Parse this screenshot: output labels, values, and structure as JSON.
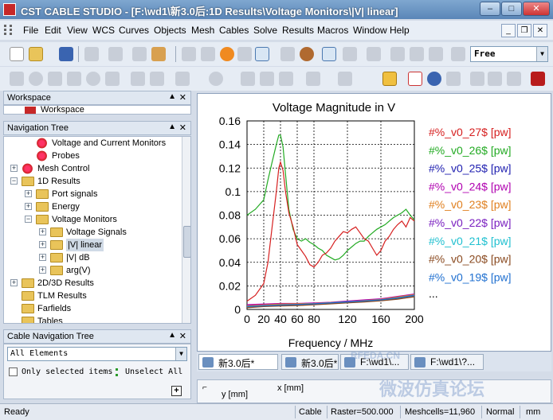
{
  "window": {
    "title": "CST CABLE STUDIO - [F:\\wd1\\新3.0后:1D Results\\Voltage Monitors\\|V| linear]",
    "minimize": "–",
    "maximize": "□",
    "close": "✕"
  },
  "menu": [
    "File",
    "Edit",
    "View",
    "WCS",
    "Curves",
    "Objects",
    "Mesh",
    "Cables",
    "Solve",
    "Results",
    "Macros",
    "Window",
    "Help"
  ],
  "mdi_buttons": [
    "_",
    "❐",
    "✕"
  ],
  "toolbar": {
    "mode_value": "Free",
    "mode_arrow": "▼"
  },
  "panels": {
    "workspace": {
      "title": "Workspace",
      "item": "Workspace"
    },
    "navigation": {
      "title": "Navigation Tree"
    },
    "cable_nav": {
      "title": "Cable Navigation Tree",
      "select_value": "All Elements",
      "only_selected": "Only selected items",
      "unselect_all": "Unselect All",
      "plus": "+"
    },
    "pin": "▲",
    "close": "✕"
  },
  "tree": [
    {
      "label": "Voltage and Current Monitors",
      "indent": 1,
      "icon": "red"
    },
    {
      "label": "Probes",
      "indent": 1,
      "icon": "red"
    },
    {
      "label": "Mesh Control",
      "indent": 0,
      "icon": "red",
      "expander": "+"
    },
    {
      "label": "1D Results",
      "indent": 0,
      "icon": "folder",
      "expander": "−"
    },
    {
      "label": "Port signals",
      "indent": 1,
      "icon": "folder",
      "expander": "+"
    },
    {
      "label": "Energy",
      "indent": 1,
      "icon": "folder",
      "expander": "+"
    },
    {
      "label": "Voltage Monitors",
      "indent": 1,
      "icon": "folder",
      "expander": "−"
    },
    {
      "label": "Voltage Signals",
      "indent": 2,
      "icon": "folder",
      "expander": "+"
    },
    {
      "label": "|V| linear",
      "indent": 2,
      "icon": "folder",
      "expander": "+",
      "selected": true
    },
    {
      "label": "|V| dB",
      "indent": 2,
      "icon": "folder",
      "expander": "+"
    },
    {
      "label": "arg(V)",
      "indent": 2,
      "icon": "folder",
      "expander": "+"
    },
    {
      "label": "2D/3D Results",
      "indent": 0,
      "icon": "folder",
      "expander": "+"
    },
    {
      "label": "TLM Results",
      "indent": 0,
      "icon": "folder"
    },
    {
      "label": "Farfields",
      "indent": 0,
      "icon": "folder"
    },
    {
      "label": "Tables",
      "indent": 0,
      "icon": "folder"
    }
  ],
  "chart_data": {
    "type": "line",
    "title": "Voltage Magnitude in V",
    "xlabel": "Frequency / MHz",
    "ylabel": "",
    "xlim": [
      0,
      200
    ],
    "ylim": [
      0,
      0.16
    ],
    "xticks": [
      0,
      20,
      40,
      60,
      80,
      120,
      160,
      200
    ],
    "yticks": [
      0,
      0.02,
      0.04,
      0.06,
      0.08,
      0.1,
      0.12,
      0.14,
      0.16
    ],
    "grid": true,
    "legend_position": "right",
    "legend_more": "...",
    "series": [
      {
        "name": "#%_v0_27$ [pw]",
        "color": "#d62020",
        "x": [
          0,
          10,
          20,
          25,
          30,
          35,
          38,
          40,
          43,
          46,
          50,
          55,
          60,
          65,
          70,
          75,
          80,
          85,
          90,
          95,
          100,
          105,
          110,
          115,
          120,
          125,
          130,
          135,
          140,
          145,
          150,
          155,
          160,
          165,
          170,
          175,
          180,
          185,
          190,
          195,
          200
        ],
        "y": [
          0.007,
          0.012,
          0.022,
          0.04,
          0.07,
          0.1,
          0.12,
          0.125,
          0.118,
          0.1,
          0.082,
          0.07,
          0.055,
          0.05,
          0.045,
          0.038,
          0.036,
          0.04,
          0.046,
          0.048,
          0.052,
          0.058,
          0.062,
          0.066,
          0.065,
          0.068,
          0.07,
          0.065,
          0.06,
          0.058,
          0.052,
          0.046,
          0.05,
          0.058,
          0.062,
          0.068,
          0.072,
          0.075,
          0.07,
          0.078,
          0.075
        ]
      },
      {
        "name": "#%_v0_26$ [pw]",
        "color": "#22aa22",
        "x": [
          0,
          10,
          20,
          25,
          30,
          35,
          38,
          40,
          43,
          46,
          50,
          55,
          60,
          65,
          70,
          75,
          80,
          85,
          90,
          95,
          100,
          105,
          110,
          115,
          120,
          125,
          130,
          135,
          140,
          145,
          150,
          155,
          160,
          165,
          170,
          175,
          180,
          185,
          190,
          195,
          200
        ],
        "y": [
          0.08,
          0.085,
          0.093,
          0.11,
          0.125,
          0.14,
          0.148,
          0.148,
          0.138,
          0.115,
          0.085,
          0.068,
          0.06,
          0.058,
          0.06,
          0.057,
          0.055,
          0.052,
          0.05,
          0.046,
          0.044,
          0.042,
          0.043,
          0.046,
          0.05,
          0.053,
          0.056,
          0.058,
          0.058,
          0.062,
          0.065,
          0.068,
          0.07,
          0.072,
          0.075,
          0.078,
          0.08,
          0.082,
          0.085,
          0.08,
          0.076
        ]
      },
      {
        "name": "#%_v0_25$ [pw]",
        "color": "#2020b0",
        "x": [
          0,
          20,
          40,
          60,
          80,
          100,
          120,
          140,
          160,
          180,
          200
        ],
        "y": [
          0.003,
          0.0035,
          0.004,
          0.004,
          0.0045,
          0.005,
          0.006,
          0.007,
          0.008,
          0.01,
          0.012
        ]
      },
      {
        "name": "#%_v0_24$ [pw]",
        "color": "#b000b0",
        "x": [
          0,
          20,
          40,
          60,
          80,
          100,
          120,
          140,
          160,
          180,
          200
        ],
        "y": [
          0.004,
          0.0045,
          0.005,
          0.005,
          0.0055,
          0.006,
          0.007,
          0.008,
          0.009,
          0.011,
          0.013
        ]
      },
      {
        "name": "#%_v0_23$ [pw]",
        "color": "#e08020",
        "x": [
          0,
          20,
          40,
          60,
          80,
          100,
          120,
          140,
          160,
          180,
          200
        ],
        "y": [
          0.003,
          0.0038,
          0.0045,
          0.0048,
          0.005,
          0.0058,
          0.0065,
          0.0075,
          0.0085,
          0.0105,
          0.0125
        ]
      },
      {
        "name": "#%_v0_22$ [pw]",
        "color": "#7a20c0",
        "x": [
          0,
          20,
          40,
          60,
          80,
          100,
          120,
          140,
          160,
          180,
          200
        ],
        "y": [
          0.002,
          0.003,
          0.0035,
          0.004,
          0.0045,
          0.0052,
          0.006,
          0.0068,
          0.0078,
          0.0095,
          0.0115
        ]
      },
      {
        "name": "#%_v0_21$ [pw]",
        "color": "#20c0d0",
        "x": [
          0,
          20,
          40,
          60,
          80,
          100,
          120,
          140,
          160,
          180,
          200
        ],
        "y": [
          0.002,
          0.0028,
          0.0032,
          0.0036,
          0.0042,
          0.005,
          0.0058,
          0.0066,
          0.0076,
          0.009,
          0.011
        ]
      },
      {
        "name": "#%_v0_20$ [pw]",
        "color": "#8a4a20",
        "x": [
          0,
          20,
          40,
          60,
          80,
          100,
          120,
          140,
          160,
          180,
          200
        ],
        "y": [
          0.0015,
          0.0025,
          0.003,
          0.0034,
          0.004,
          0.0048,
          0.0056,
          0.0064,
          0.0074,
          0.0088,
          0.0108
        ]
      },
      {
        "name": "#%_v0_19$ [pw]",
        "color": "#2070d0",
        "x": [
          0,
          20,
          40,
          60,
          80,
          100,
          120,
          140,
          160,
          180,
          200
        ],
        "y": [
          0.0025,
          0.0032,
          0.0038,
          0.0042,
          0.0048,
          0.0056,
          0.0064,
          0.0072,
          0.0082,
          0.0098,
          0.012
        ]
      }
    ]
  },
  "tabs": [
    {
      "label": "新3.0后*",
      "active": true
    },
    {
      "label": "新3.0后*",
      "active": false
    },
    {
      "label": "F:\\wd1\\...",
      "active": false
    },
    {
      "label": "F:\\wd1\\?...",
      "active": false
    }
  ],
  "bottom_panel": {
    "x_label": "x [mm]",
    "y_label": "y [mm]"
  },
  "status": {
    "ready": "Ready",
    "mode": "Cable",
    "raster": "Raster=500.000",
    "meshcells": "Meshcells=11,960",
    "view": "Normal",
    "units": "mm"
  },
  "watermarks": {
    "top": "RFEDA.CN",
    "bottom": "微波仿真论坛"
  }
}
